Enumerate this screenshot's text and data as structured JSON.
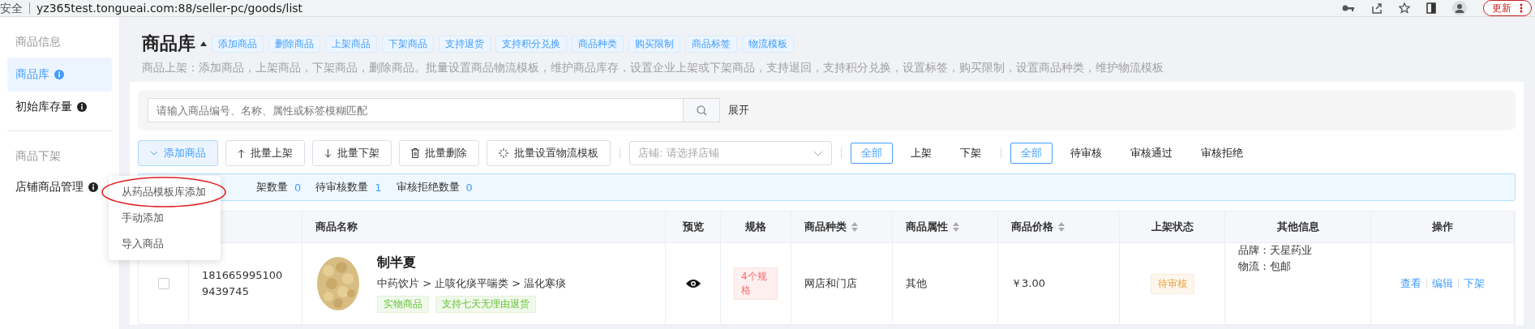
{
  "browser": {
    "security": "安全",
    "url": "yz365test.tongueai.com:88/seller-pc/goods/list",
    "update_button": "更新"
  },
  "sidebar": [
    {
      "heading": "商品信息",
      "items": [
        {
          "label": "商品库",
          "selected": true
        },
        {
          "label": "初始库存量",
          "selected": false
        }
      ]
    },
    {
      "heading": "商品下架",
      "items": [
        {
          "label": "店铺商品管理",
          "selected": false
        }
      ]
    }
  ],
  "page": {
    "title": "商品库",
    "tags": [
      "添加商品",
      "删除商品",
      "上架商品",
      "下架商品",
      "支持退货",
      "支持积分兑换",
      "商品种类",
      "购买限制",
      "商品标签",
      "物流模板"
    ],
    "description": "商品上架：添加商品，上架商品，下架商品，删除商品。批量设置商品物流模板，维护商品库存，设置企业上架或下架商品，支持退回，支持积分兑换，设置标签，购买限制，设置商品种类，维护物流模板"
  },
  "search": {
    "placeholder": "请输入商品编号、名称、属性或标签模糊匹配",
    "expand": "展开"
  },
  "toolbar": [
    {
      "label": "添加商品",
      "selected": true
    },
    {
      "label": "批量上架",
      "selected": false
    },
    {
      "label": "批量下架",
      "selected": false
    },
    {
      "label": "批量删除",
      "selected": false
    },
    {
      "label": "批量设置物流模板",
      "selected": false
    }
  ],
  "store_select": {
    "label": "店铺:",
    "placeholder": "请选择店铺"
  },
  "shelf_filter": [
    {
      "label": "全部",
      "selected": true
    },
    {
      "label": "上架",
      "selected": false
    },
    {
      "label": "下架",
      "selected": false
    }
  ],
  "review_filter": [
    {
      "label": "全部",
      "selected": true
    },
    {
      "label": "待审核",
      "selected": false
    },
    {
      "label": "审核通过",
      "selected": false
    },
    {
      "label": "审核拒绝",
      "selected": false
    }
  ],
  "stats": [
    {
      "label": "架数量",
      "value": "0"
    },
    {
      "label": "待审核数量",
      "value": "1"
    },
    {
      "label": "审核拒绝数量",
      "value": "0"
    }
  ],
  "dropdown": [
    {
      "label": "从药品模板库添加",
      "circled": true
    },
    {
      "label": "手动添加",
      "circled": false
    },
    {
      "label": "导入商品",
      "circled": false
    }
  ],
  "table": {
    "columns": [
      {
        "label": "商品名称",
        "sortable": false
      },
      {
        "label": "预览",
        "sortable": false
      },
      {
        "label": "规格",
        "sortable": false
      },
      {
        "label": "商品种类",
        "sortable": true
      },
      {
        "label": "商品属性",
        "sortable": true
      },
      {
        "label": "商品价格",
        "sortable": true
      },
      {
        "label": "上架状态",
        "sortable": false
      },
      {
        "label": "其他信息",
        "sortable": false
      },
      {
        "label": "操作",
        "sortable": false
      }
    ],
    "rows": [
      {
        "checked": false,
        "code": "1816659951009439745",
        "name": "制半夏",
        "category_path": "中药饮片 > 止咳化痰平喘类 > 温化寒痰",
        "tags": [
          "实物商品",
          "支持七天无理由退货"
        ],
        "spec": "4个规格",
        "type": "网店和门店",
        "attribute": "其他",
        "price": "￥3.00",
        "status": "待审核",
        "other": [
          "品牌：天星药业",
          "物流：包邮"
        ],
        "actions": [
          "查看",
          "编辑",
          "下架"
        ]
      }
    ]
  }
}
